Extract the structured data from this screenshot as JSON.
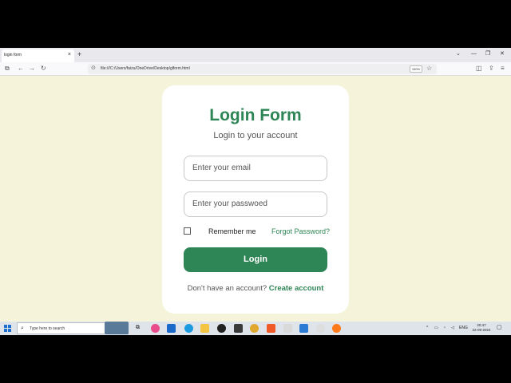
{
  "browser": {
    "tab_title": "login form",
    "tab_close": "×",
    "new_tab": "+",
    "url": "file:///C:/Users/faizu/OneDrive/Desktop/glform.html",
    "zoom": "150%",
    "window_controls": [
      "⌄",
      "—",
      "❐",
      "✕"
    ]
  },
  "form": {
    "title": "Login Form",
    "subtitle": "Login to your account",
    "email_placeholder": "Enter your email",
    "password_placeholder": "Enter your passwoed",
    "remember_label": "Remember me",
    "forgot_label": "Forgot Password?",
    "login_label": "Login",
    "signup_prompt": "Don't have an account?",
    "signup_link": "Create account"
  },
  "colors": {
    "accent": "#2e8555",
    "page_bg": "#f5f4db"
  },
  "taskbar": {
    "search_placeholder": "Type here to search",
    "lang": "ENG",
    "time": "20:47",
    "date": "22-09-2024"
  }
}
